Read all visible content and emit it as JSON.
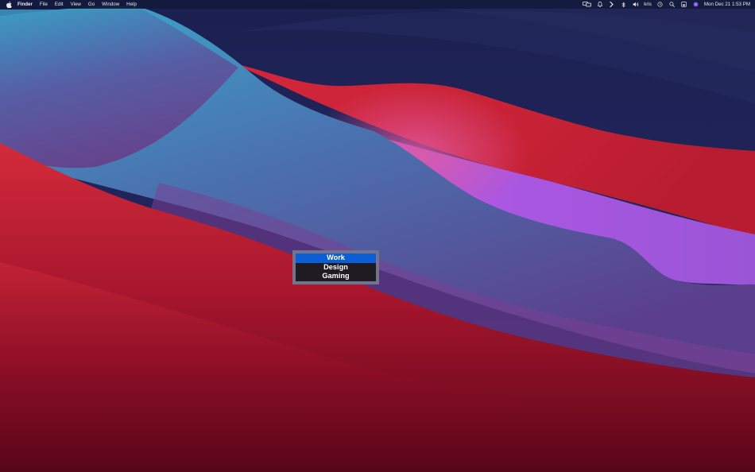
{
  "menubar": {
    "apple_icon": "apple-logo-icon",
    "app_name": "Finder",
    "menus": [
      "File",
      "Edit",
      "View",
      "Go",
      "Window",
      "Help"
    ],
    "status_icons": [
      "display-icon",
      "notification-bell-icon",
      "chevron-right-icon",
      "bluetooth-icon",
      "volume-icon"
    ],
    "user": "kris",
    "status_icons_after_user": [
      "time-machine-icon",
      "spotlight-search-icon",
      "control-center-icon",
      "siri-icon"
    ],
    "clock": "Mon Dec 21  1:53 PM"
  },
  "switcher": {
    "items": [
      {
        "label": "Work",
        "selected": true
      },
      {
        "label": "Design",
        "selected": false
      },
      {
        "label": "Gaming",
        "selected": false
      }
    ],
    "colors": {
      "frame": "#75728c",
      "list_bg": "#1e1b23",
      "selected": "#0b5fd6",
      "text": "#ffffff"
    }
  },
  "wallpaper": {
    "name": "macOS Big Sur",
    "colors": [
      "#1c2350",
      "#cc2a3a",
      "#a65be0",
      "#3aa6c6",
      "#5a0a1c"
    ]
  }
}
